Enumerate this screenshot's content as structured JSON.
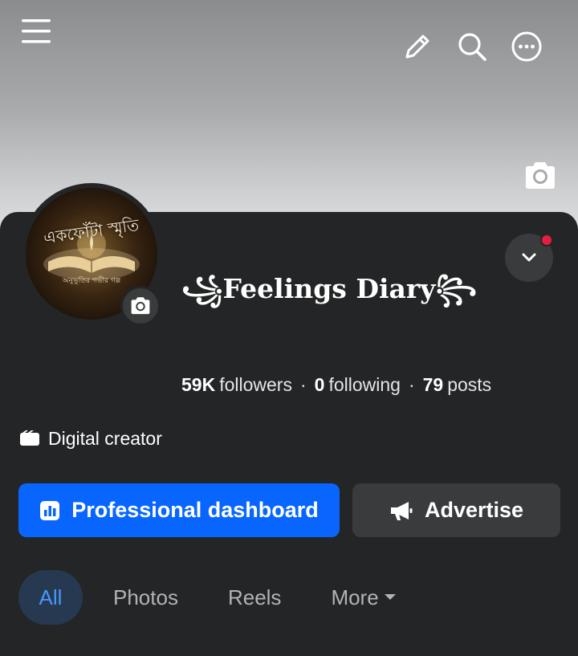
{
  "page": {
    "name": "꧁Feelings Diary꧂",
    "stats": {
      "followers_value": "59K",
      "followers_label": "followers",
      "following_value": "0",
      "following_label": "following",
      "posts_value": "79",
      "posts_label": "posts",
      "separator": "·"
    },
    "category": "Digital creator"
  },
  "avatar": {
    "title_text": "একফোঁটা স্মৃতি",
    "subtitle_text": "অনুভূতির গভীর গল্প"
  },
  "header": {
    "icons": [
      "hamburger-menu-icon",
      "pencil-icon",
      "search-icon",
      "more-options-icon"
    ]
  },
  "actions": {
    "dashboard_label": "Professional dashboard",
    "advertise_label": "Advertise"
  },
  "tabs": [
    {
      "label": "All",
      "active": true
    },
    {
      "label": "Photos",
      "active": false
    },
    {
      "label": "Reels",
      "active": false
    },
    {
      "label": "More",
      "active": false
    }
  ],
  "colors": {
    "primary": "#0866ff",
    "panel": "#242526",
    "secondary_button": "#3a3b3c",
    "active_tab_bg": "#263951",
    "active_tab_text": "#4599ff",
    "notification_dot": "#e41e3f"
  }
}
